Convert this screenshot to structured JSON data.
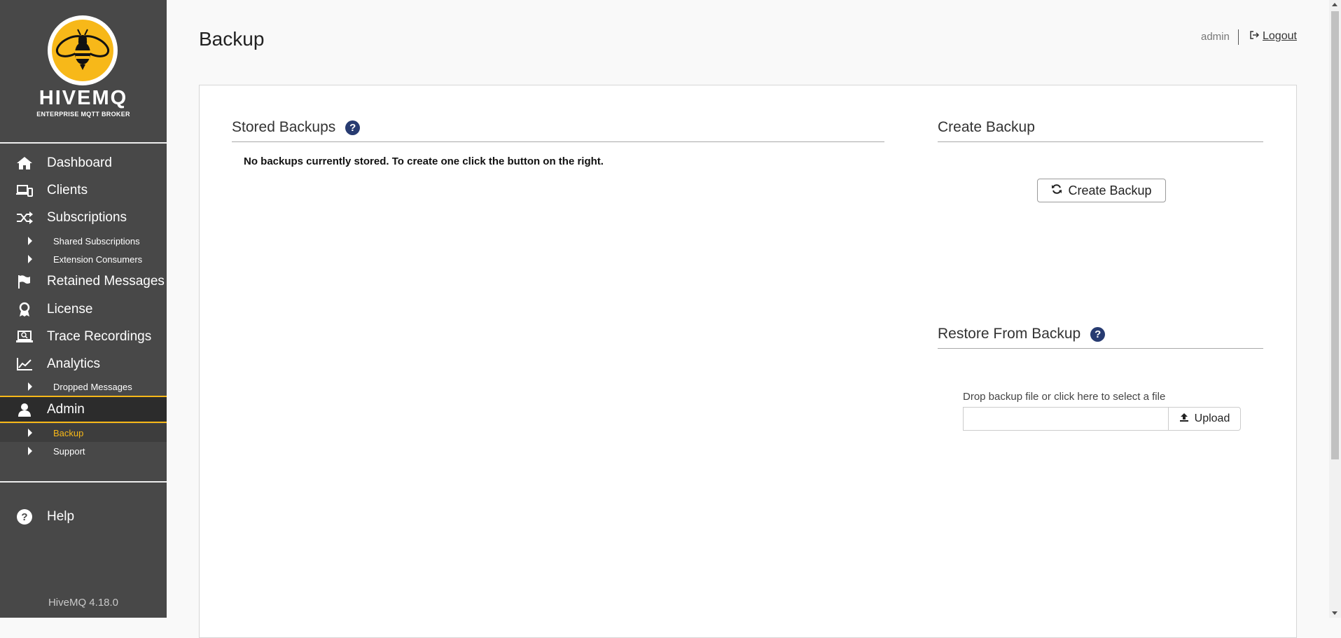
{
  "brand": {
    "name": "HIVEMQ",
    "subtitle": "ENTERPRISE MQTT BROKER",
    "accent": "#f7b819",
    "sidebar_bg": "#484848"
  },
  "sidebar": {
    "items": [
      {
        "label": "Dashboard",
        "icon": "home-icon"
      },
      {
        "label": "Clients",
        "icon": "devices-icon"
      },
      {
        "label": "Subscriptions",
        "icon": "shuffle-icon"
      },
      {
        "label": "Shared Subscriptions",
        "icon": "caret-right-icon"
      },
      {
        "label": "Extension Consumers",
        "icon": "caret-right-icon"
      },
      {
        "label": "Retained Messages",
        "icon": "flag-icon"
      },
      {
        "label": "License",
        "icon": "award-icon"
      },
      {
        "label": "Trace Recordings",
        "icon": "laptop-search-icon"
      },
      {
        "label": "Analytics",
        "icon": "line-chart-icon"
      },
      {
        "label": "Dropped Messages",
        "icon": "caret-right-icon"
      },
      {
        "label": "Admin",
        "icon": "user-icon"
      },
      {
        "label": "Backup",
        "icon": "caret-right-icon"
      },
      {
        "label": "Support",
        "icon": "caret-right-icon"
      }
    ],
    "help": "Help",
    "version": "HiveMQ 4.18.0"
  },
  "header": {
    "title": "Backup",
    "user": "admin",
    "logout": "Logout"
  },
  "stored": {
    "title": "Stored Backups",
    "empty_text": "No backups currently stored. To create one click the button on the right."
  },
  "create": {
    "title": "Create Backup",
    "button": "Create Backup"
  },
  "restore": {
    "title": "Restore From Backup",
    "drop_label": "Drop backup file or click here to select a file",
    "upload": "Upload"
  }
}
